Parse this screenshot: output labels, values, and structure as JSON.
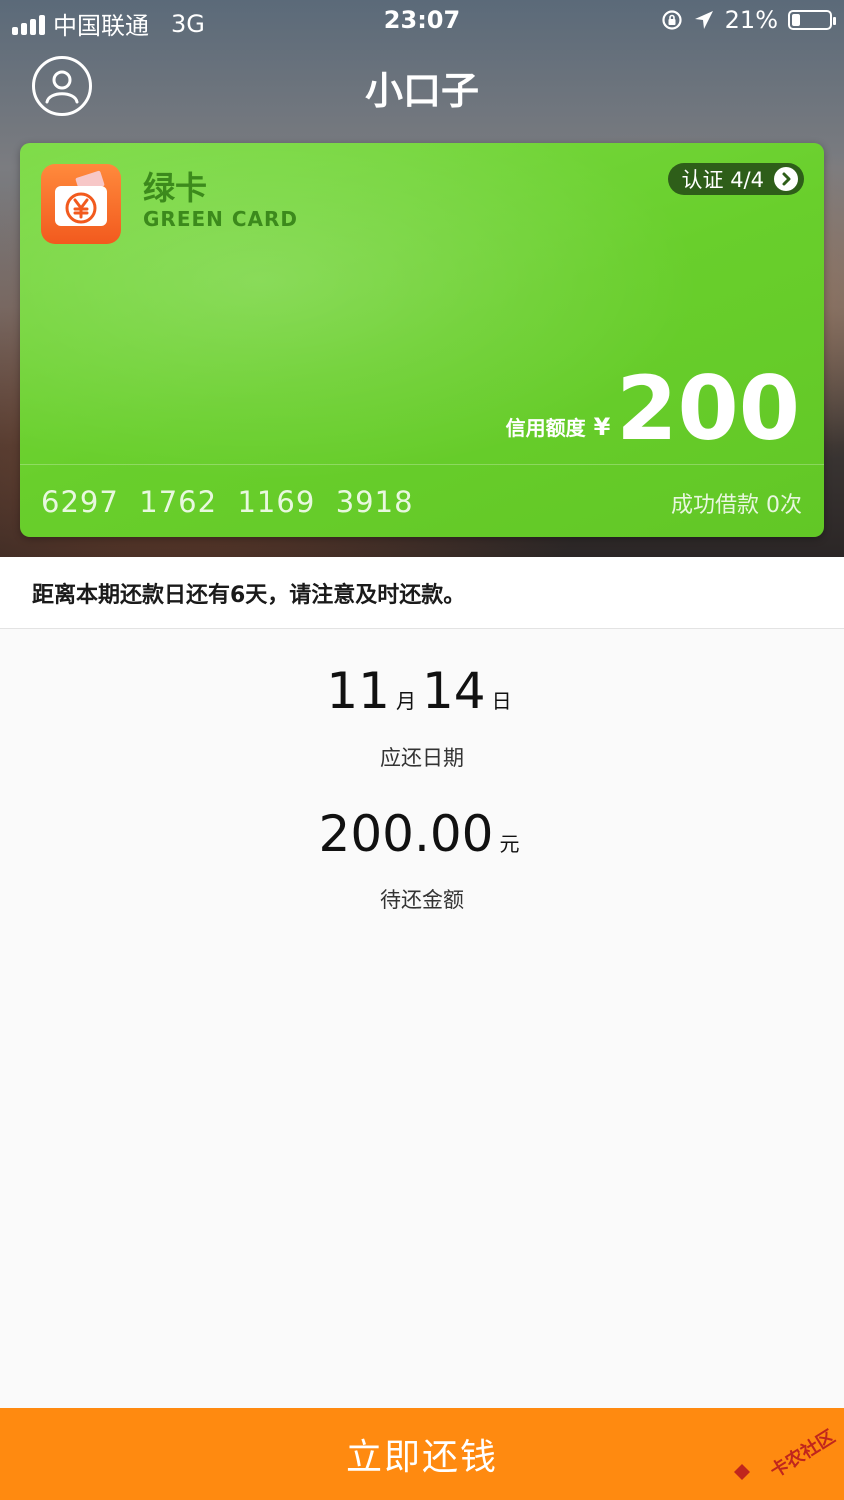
{
  "status_bar": {
    "carrier": "中国联通",
    "network": "3G",
    "time": "23:07",
    "battery": "21%",
    "battery_level": 0.21
  },
  "nav": {
    "title": "小口子"
  },
  "card": {
    "name": "绿卡",
    "subtitle": "GREEN CARD",
    "verification": "认证 4/4",
    "limit_label": "信用额度",
    "currency": "¥",
    "limit_value": "200",
    "card_number": "6297  1762  1169  3918",
    "success_count": "成功借款 0次"
  },
  "notice": {
    "text": "距离本期还款日还有6天，请注意及时还款。"
  },
  "due": {
    "month": "11",
    "month_unit": "月",
    "day": "14",
    "day_unit": "日",
    "label": "应还日期"
  },
  "amount": {
    "value": "200.00",
    "unit": "元",
    "label": "待还金额"
  },
  "action": {
    "pay_label": "立即还钱"
  },
  "watermark": {
    "text": "卡农社区"
  },
  "colors": {
    "card_green": "#69cf2c",
    "accent_orange": "#ff8a10",
    "verify_bg": "#2e5e19"
  }
}
